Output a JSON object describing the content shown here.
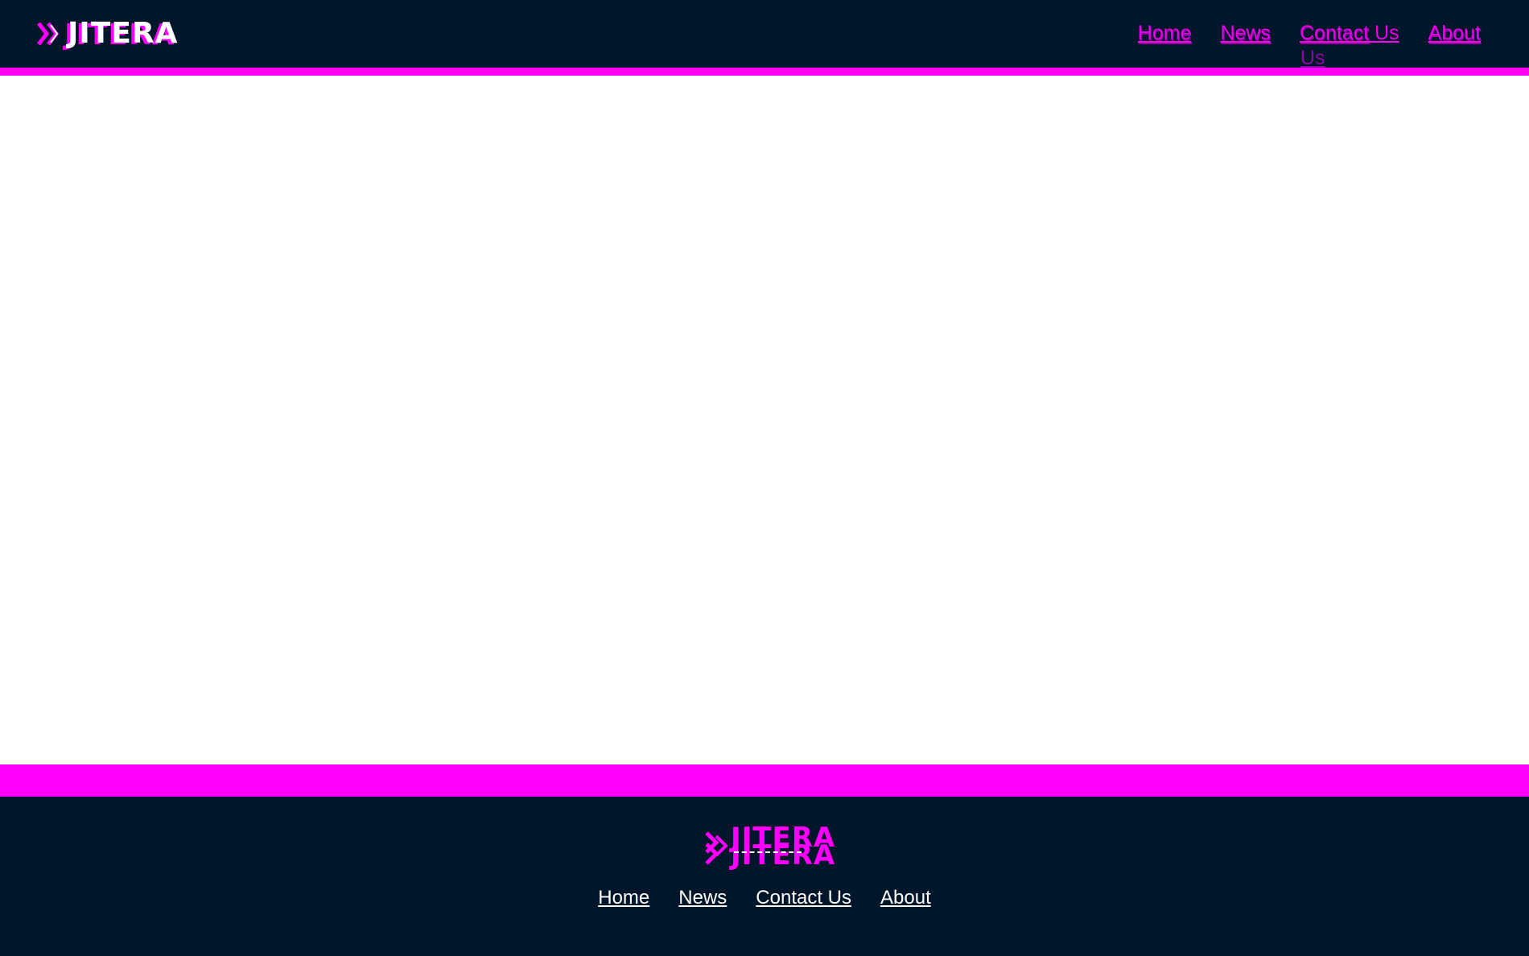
{
  "brand": {
    "name": "JITERA",
    "icon": "double-chevron-icon",
    "accent_color": "#ff00ff",
    "dark_color": "#00162b"
  },
  "header_nav": [
    {
      "label": "Home"
    },
    {
      "label": "News"
    },
    {
      "label": "Contact Us"
    },
    {
      "label": "About"
    }
  ],
  "footer_nav": [
    {
      "label": "Home"
    },
    {
      "label": "News"
    },
    {
      "label": "Contact Us"
    },
    {
      "label": "About"
    }
  ]
}
